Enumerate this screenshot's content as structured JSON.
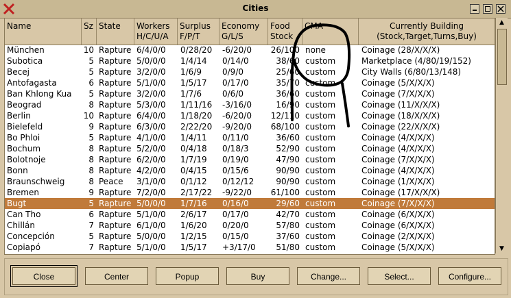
{
  "window": {
    "title": "Cities"
  },
  "columns": {
    "name": [
      "",
      "Name"
    ],
    "sz": [
      "",
      "Sz"
    ],
    "state": [
      "",
      "State"
    ],
    "workers": [
      "Workers",
      "H/C/U/A"
    ],
    "surplus": [
      "Surplus",
      "F/P/T"
    ],
    "economy": [
      "Economy",
      "G/L/S"
    ],
    "food": [
      "Food",
      "Stock"
    ],
    "cma": [
      "",
      "CMA"
    ],
    "building": [
      "Currently Building",
      "(Stock,Target,Turns,Buy)"
    ]
  },
  "rows": [
    {
      "name": "München",
      "sz": "10",
      "state": "Rapture",
      "workers": "6/4/0/0",
      "surplus": "0/28/20",
      "economy": "-6/20/0",
      "food": "26/100",
      "cma": "none",
      "building": "Coinage (28/X/X/X)"
    },
    {
      "name": "Subotica",
      "sz": "5",
      "state": "Rapture",
      "workers": "5/0/0/0",
      "surplus": "1/4/14",
      "economy": "0/14/0",
      "food": "38/60",
      "cma": "custom",
      "building": "Marketplace (4/80/19/152)"
    },
    {
      "name": "Becej",
      "sz": "5",
      "state": "Rapture",
      "workers": "3/2/0/0",
      "surplus": "1/6/9",
      "economy": "0/9/0",
      "food": "25/60",
      "cma": "custom",
      "building": "City Walls (6/80/13/148)"
    },
    {
      "name": "Antofagasta",
      "sz": "6",
      "state": "Rapture",
      "workers": "5/1/0/0",
      "surplus": "1/5/17",
      "economy": "0/17/0",
      "food": "35/70",
      "cma": "custom",
      "building": "Coinage (5/X/X/X)"
    },
    {
      "name": "Ban Khlong Kua",
      "sz": "5",
      "state": "Rapture",
      "workers": "3/2/0/0",
      "surplus": "1/7/6",
      "economy": "0/6/0",
      "food": "36/60",
      "cma": "custom",
      "building": "Coinage (7/X/X/X)"
    },
    {
      "name": "Beograd",
      "sz": "8",
      "state": "Rapture",
      "workers": "5/3/0/0",
      "surplus": "1/11/16",
      "economy": "-3/16/0",
      "food": "16/90",
      "cma": "custom",
      "building": "Coinage (11/X/X/X)"
    },
    {
      "name": "Berlin",
      "sz": "10",
      "state": "Rapture",
      "workers": "6/4/0/0",
      "surplus": "1/18/20",
      "economy": "-6/20/0",
      "food": "12/110",
      "cma": "custom",
      "building": "Coinage (18/X/X/X)"
    },
    {
      "name": "Bielefeld",
      "sz": "9",
      "state": "Rapture",
      "workers": "6/3/0/0",
      "surplus": "2/22/20",
      "economy": "-9/20/0",
      "food": "68/100",
      "cma": "custom",
      "building": "Coinage (22/X/X/X)"
    },
    {
      "name": "Bo Phloi",
      "sz": "5",
      "state": "Rapture",
      "workers": "4/1/0/0",
      "surplus": "1/4/11",
      "economy": "0/11/0",
      "food": "36/60",
      "cma": "custom",
      "building": "Coinage (4/X/X/X)"
    },
    {
      "name": "Bochum",
      "sz": "8",
      "state": "Rapture",
      "workers": "5/2/0/0",
      "surplus": "0/4/18",
      "economy": "0/18/3",
      "food": "52/90",
      "cma": "custom",
      "building": "Coinage (4/X/X/X)"
    },
    {
      "name": "Bolotnoje",
      "sz": "8",
      "state": "Rapture",
      "workers": "6/2/0/0",
      "surplus": "1/7/19",
      "economy": "0/19/0",
      "food": "47/90",
      "cma": "custom",
      "building": "Coinage (7/X/X/X)"
    },
    {
      "name": "Bonn",
      "sz": "8",
      "state": "Rapture",
      "workers": "4/2/0/0",
      "surplus": "0/4/15",
      "economy": "0/15/6",
      "food": "90/90",
      "cma": "custom",
      "building": "Coinage (4/X/X/X)"
    },
    {
      "name": "Braunschweig",
      "sz": "8",
      "state": "Peace",
      "workers": "3/1/0/0",
      "surplus": "0/1/12",
      "economy": "0/12/12",
      "food": "90/90",
      "cma": "custom",
      "building": "Coinage (1/X/X/X)"
    },
    {
      "name": "Bremen",
      "sz": "9",
      "state": "Rapture",
      "workers": "7/2/0/0",
      "surplus": "2/17/22",
      "economy": "-9/22/0",
      "food": "61/100",
      "cma": "custom",
      "building": "Coinage (17/X/X/X)"
    },
    {
      "name": "Bugt",
      "sz": "5",
      "state": "Rapture",
      "workers": "5/0/0/0",
      "surplus": "1/7/16",
      "economy": "0/16/0",
      "food": "29/60",
      "cma": "custom",
      "building": "Coinage (7/X/X/X)",
      "selected": true
    },
    {
      "name": "Can Tho",
      "sz": "6",
      "state": "Rapture",
      "workers": "5/1/0/0",
      "surplus": "2/6/17",
      "economy": "0/17/0",
      "food": "42/70",
      "cma": "custom",
      "building": "Coinage (6/X/X/X)"
    },
    {
      "name": "Chillán",
      "sz": "7",
      "state": "Rapture",
      "workers": "6/1/0/0",
      "surplus": "1/6/20",
      "economy": "0/20/0",
      "food": "57/80",
      "cma": "custom",
      "building": "Coinage (6/X/X/X)"
    },
    {
      "name": "Concepción",
      "sz": "5",
      "state": "Rapture",
      "workers": "5/0/0/0",
      "surplus": "1/2/15",
      "economy": "0/15/0",
      "food": "37/60",
      "cma": "custom",
      "building": "Coinage (2/X/X/X)"
    },
    {
      "name": "Copiapó",
      "sz": "7",
      "state": "Rapture",
      "workers": "5/1/0/0",
      "surplus": "1/5/17",
      "economy": "+3/17/0",
      "food": "51/80",
      "cma": "custom",
      "building": "Coinage (5/X/X/X)"
    }
  ],
  "buttons": {
    "close": "Close",
    "center": "Center",
    "popup": "Popup",
    "buy": "Buy",
    "change": "Change...",
    "select": "Select...",
    "configure": "Configure..."
  },
  "colors": {
    "selected_row": "#c07a3a",
    "window_bg": "#d8c7a7"
  },
  "icons": {
    "window": "close-x-icon"
  }
}
